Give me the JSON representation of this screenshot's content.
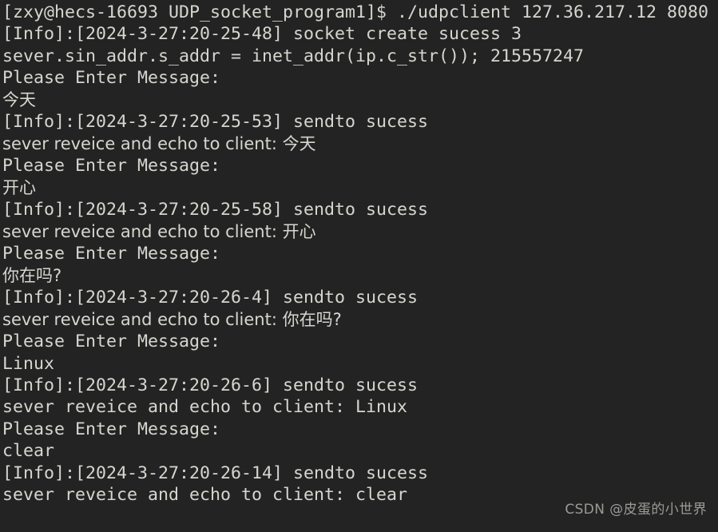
{
  "terminal": {
    "background_color": "#232323",
    "foreground_color": "#d6d6d0",
    "prompt": "[zxy@hecs-16693 UDP_socket_program1]$",
    "command": "./udpclient 127.36.217.12 8080",
    "server_ip": "127.36.217.12",
    "server_port": "8080",
    "program": "./udpclient",
    "user": "zxy",
    "host": "hecs-16693",
    "cwd": "UDP_socket_program1",
    "lines": [
      "[zxy@hecs-16693 UDP_socket_program1]$ ./udpclient 127.36.217.12 8080",
      "[Info]:[2024-3-27:20-25-48] socket create sucess 3",
      "sever.sin_addr.s_addr = inet_addr(ip.c_str()); 215557247",
      "Please Enter Message:",
      "今天",
      "[Info]:[2024-3-27:20-25-53] sendto sucess",
      "sever reveice and echo to client: 今天",
      "Please Enter Message:",
      "开心",
      "[Info]:[2024-3-27:20-25-58] sendto sucess",
      "sever reveice and echo to client: 开心",
      "Please Enter Message:",
      "你在吗?",
      "[Info]:[2024-3-27:20-26-4] sendto sucess",
      "sever reveice and echo to client: 你在吗?",
      "Please Enter Message:",
      "Linux",
      "[Info]:[2024-3-27:20-26-6] sendto sucess",
      "sever reveice and echo to client: Linux",
      "Please Enter Message:",
      "clear",
      "[Info]:[2024-3-27:20-26-14] sendto sucess",
      "sever reveice and echo to client: clear"
    ],
    "cjk_line_indexes": [
      4,
      6,
      8,
      10,
      12,
      14
    ],
    "log_entries": [
      {
        "level": "[Info]",
        "timestamp": "2024-3-27:20-25-48",
        "message": "socket create sucess 3"
      },
      {
        "level": "[Info]",
        "timestamp": "2024-3-27:20-25-53",
        "message": "sendto sucess"
      },
      {
        "level": "[Info]",
        "timestamp": "2024-3-27:20-25-58",
        "message": "sendto sucess"
      },
      {
        "level": "[Info]",
        "timestamp": "2024-3-27:20-26-4",
        "message": "sendto sucess"
      },
      {
        "level": "[Info]",
        "timestamp": "2024-3-27:20-26-6",
        "message": "sendto sucess"
      },
      {
        "level": "[Info]",
        "timestamp": "2024-3-27:20-26-14",
        "message": "sendto sucess"
      }
    ],
    "messages_sent": [
      "今天",
      "开心",
      "你在吗?",
      "Linux",
      "clear"
    ],
    "echo_prefix": "sever reveice and echo to client: ",
    "input_prompt": "Please Enter Message:",
    "addr_line": "sever.sin_addr.s_addr = inet_addr(ip.c_str()); 215557247",
    "addr_value": "215557247"
  },
  "watermark": {
    "text": "CSDN @皮蛋的小世界",
    "color": "#9a9a96"
  }
}
